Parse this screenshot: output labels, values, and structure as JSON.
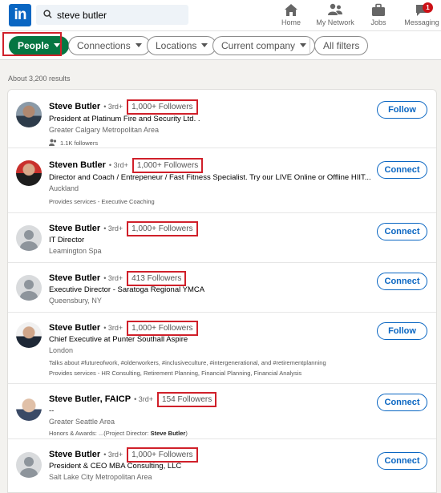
{
  "nav": {
    "logo": "in",
    "search_value": "steve butler",
    "items": [
      {
        "label": "Home",
        "icon": "home-icon"
      },
      {
        "label": "My Network",
        "icon": "network-icon"
      },
      {
        "label": "Jobs",
        "icon": "briefcase-icon"
      },
      {
        "label": "Messaging",
        "icon": "messaging-icon",
        "badge": "1"
      }
    ]
  },
  "filters": {
    "people": "People",
    "connections": "Connections",
    "locations": "Locations",
    "current_company": "Current company",
    "all_filters": "All filters"
  },
  "results_count": "About 3,200 results",
  "results": [
    {
      "name": "Steve Butler",
      "degree": "• 3rd+",
      "followers": "1,000+ Followers",
      "headline": "President at Platinum Fire and Security Ltd. .",
      "location": "Greater Calgary Metropolitan Area",
      "extra": "1.1K followers",
      "action": "Follow"
    },
    {
      "name": "Steven Butler",
      "degree": "• 3rd+",
      "followers": "1,000+ Followers",
      "headline": "Director and Coach / Entrepeneur / Fast Fitness Specialist. Try our LIVE Online or Offline HIIT...",
      "location": "Auckland",
      "extra": "Provides services - Executive Coaching",
      "action": "Connect"
    },
    {
      "name": "Steve Butler",
      "degree": "• 3rd+",
      "followers": "1,000+ Followers",
      "headline": "IT Director",
      "location": "Leamington Spa",
      "action": "Connect"
    },
    {
      "name": "Steve Butler",
      "degree": "• 3rd+",
      "followers": "413 Followers",
      "headline": "Executive Director - Saratoga Regional YMCA",
      "location": "Queensbury, NY",
      "action": "Connect"
    },
    {
      "name": "Steve Butler",
      "degree": "• 3rd+",
      "followers": "1,000+ Followers",
      "headline": "Chief Executive at Punter Southall Aspire",
      "location": "London",
      "extra": "Talks about #futureofwork, #olderworkers, #inclusiveculture, #intergenerational, and #retirementplanning",
      "extra2": "Provides services - HR Consulting, Retirement Planning, Financial Planning, Financial Analysis",
      "action": "Follow"
    },
    {
      "name": "Steve Butler, FAICP",
      "degree": "• 3rd+",
      "followers": "154 Followers",
      "headline": "--",
      "location": "Greater Seattle Area",
      "extra_prefix": "Honors & Awards: ...(Project Director: ",
      "extra_bold": "Steve Butler",
      "extra_suffix": ")",
      "action": "Connect"
    },
    {
      "name": "Steve Butler",
      "degree": "• 3rd+",
      "followers": "1,000+ Followers",
      "headline": "President & CEO MBA Consulting, LLC",
      "location": "Salt Lake City Metropolitan Area",
      "action": "Connect"
    }
  ]
}
